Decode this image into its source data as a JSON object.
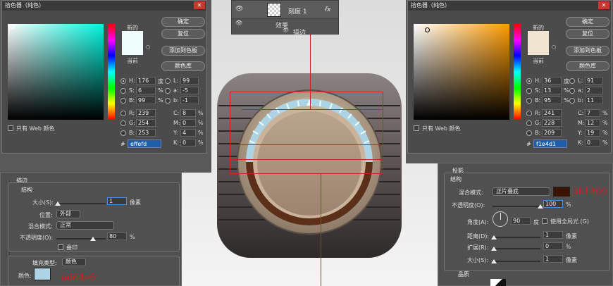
{
  "picker_left": {
    "title": "拾色器（纯色）",
    "close": "✕",
    "buttons": {
      "ok": "确定",
      "reset": "复位",
      "add": "添加到色板",
      "library": "颜色库"
    },
    "new_label": "新的",
    "current_label": "当前",
    "new_color": "#effefd",
    "current_color": "#effefd",
    "field_hue": "#00f5dc",
    "fields": {
      "H": "176",
      "H_unit": "度",
      "S": "6",
      "S_unit": "%",
      "B": "99",
      "B_unit": "%",
      "R": "239",
      "G": "254",
      "Bl": "253",
      "L": "99",
      "a": "-5",
      "b": "-1",
      "C": "8",
      "M": "0",
      "Y": "4",
      "K": "0"
    },
    "labels": {
      "H": "H:",
      "S": "S:",
      "B": "B:",
      "R": "R:",
      "G": "G:",
      "Bl": "B:",
      "L": "L:",
      "a": "a:",
      "b": "b:",
      "C": "C:",
      "M": "M:",
      "Y": "Y:",
      "K": "K:",
      "pct": "%"
    },
    "web_only": "只有 Web 颜色",
    "hash": "#",
    "hex": "effefd"
  },
  "picker_right": {
    "title": "拾色器（纯色）",
    "close": "✕",
    "buttons": {
      "ok": "确定",
      "reset": "复位",
      "add": "添加到色板",
      "library": "颜色库"
    },
    "new_label": "新的",
    "current_label": "当前",
    "new_color": "#f1e4d1",
    "current_color": "#f1e4d1",
    "field_hue": "#ff9a00",
    "fields": {
      "H": "36",
      "H_unit": "度",
      "S": "13",
      "S_unit": "%",
      "B": "95",
      "B_unit": "%",
      "R": "241",
      "G": "228",
      "Bl": "209",
      "L": "91",
      "a": "2",
      "b": "11",
      "C": "7",
      "M": "12",
      "Y": "19",
      "K": "0"
    },
    "labels": {
      "H": "H:",
      "S": "S:",
      "B": "B:",
      "R": "R:",
      "G": "G:",
      "Bl": "B:",
      "L": "L:",
      "a": "a:",
      "b": "b:",
      "C": "C:",
      "M": "M:",
      "Y": "Y:",
      "K": "K:",
      "pct": "%"
    },
    "web_only": "只有 Web 颜色",
    "hash": "#",
    "hex": "f1e4d1"
  },
  "layers": {
    "layer_name": "刻度 1",
    "fx": "fx",
    "effects": "效果",
    "stroke": "描边"
  },
  "stroke_panel": {
    "title": "描边",
    "structure": "结构",
    "size_label": "大小(S):",
    "size_value": "1",
    "size_unit": "像素",
    "position_label": "位置:",
    "position_value": "外部",
    "blend_label": "混合模式:",
    "blend_value": "正常",
    "opacity_label": "不透明度(O):",
    "opacity_value": "80",
    "opacity_unit": "%",
    "overprint": "叠印",
    "fill_type_label": "填充类型:",
    "fill_type_value": "颜色",
    "color_label": "颜色:",
    "color_value": "#add4e5",
    "note": "add4e5"
  },
  "shadow_panel": {
    "title": "投影",
    "structure": "结构",
    "blend_label": "混合模式:",
    "blend_value": "正片叠底",
    "color": "#3b1400",
    "note": "3b1400",
    "opacity_label": "不透明度(O):",
    "opacity_value": "100",
    "opacity_unit": "%",
    "angle_label": "角度(A):",
    "angle_value": "90",
    "angle_unit": "度",
    "global_light": "使用全局光 (G)",
    "distance_label": "距离(D):",
    "distance_value": "1",
    "distance_unit": "像素",
    "spread_label": "扩展(R):",
    "spread_value": "0",
    "spread_unit": "%",
    "size_label": "大小(S):",
    "size_value": "1",
    "size_unit": "像素",
    "quality": "品质"
  }
}
